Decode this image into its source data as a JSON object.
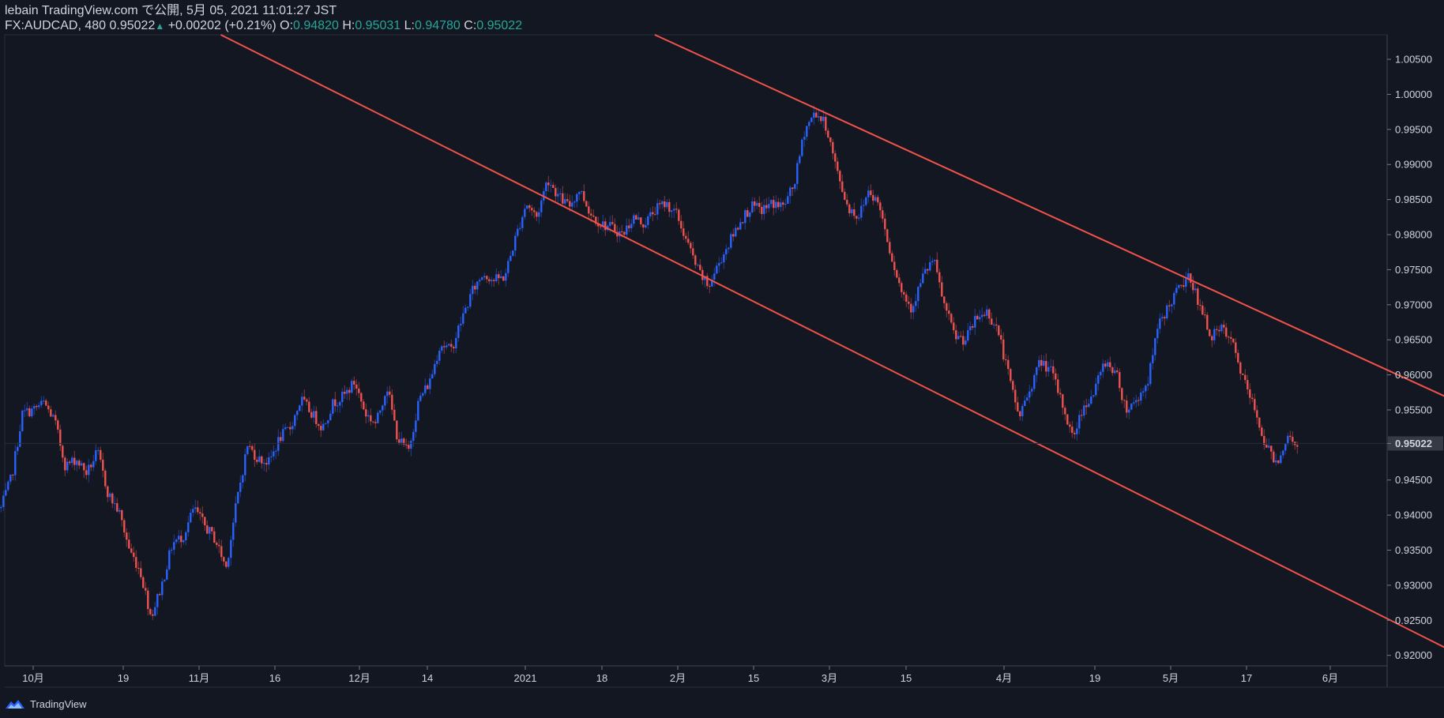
{
  "header": {
    "line1": "lebain TradingView.com で公開, 5月 05, 2021 11:01:27 JST",
    "symbol": "FX:AUDCAD, 480",
    "last": "0.95022",
    "arrow": "▲",
    "change": "+0.00202 (+0.21%)",
    "o_label": "O:",
    "o_value": "0.94820",
    "h_label": "H:",
    "h_value": "0.95031",
    "l_label": "L:",
    "l_value": "0.94780",
    "c_label": "C:",
    "c_value": "0.95022"
  },
  "footer": {
    "brand": "TradingView",
    "logo_icon": "tradingview-logo-icon"
  },
  "colors": {
    "background": "#131722",
    "up": "#2962ff",
    "down": "#ef5350",
    "trendline": "#f0524a",
    "last_label_bg": "#363a45",
    "text": "#d1d4dc"
  },
  "chart_data": {
    "type": "candlestick",
    "symbol": "FX:AUDCAD",
    "interval": "480",
    "x_ticks": [
      "10月",
      "19",
      "11月",
      "16",
      "12月",
      "14",
      "2021",
      "18",
      "2月",
      "15",
      "3月",
      "15",
      "4月",
      "19",
      "5月",
      "17",
      "6月"
    ],
    "y_ticks": [
      "1.00500",
      "1.00000",
      "0.99500",
      "0.99000",
      "0.98500",
      "0.98000",
      "0.97500",
      "0.97000",
      "0.96500",
      "0.96000",
      "0.95500",
      "0.95022",
      "0.94500",
      "0.94000",
      "0.93500",
      "0.93000",
      "0.92500",
      "0.92000"
    ],
    "ylim": [
      0.9185,
      1.0085
    ],
    "last_price": 0.95022,
    "close_path": [
      [
        "2020-09-25",
        0.941
      ],
      [
        "2020-09-27",
        0.9455
      ],
      [
        "2020-09-29",
        0.9545
      ],
      [
        "2020-10-01",
        0.955
      ],
      [
        "2020-10-03",
        0.956
      ],
      [
        "2020-10-05",
        0.9535
      ],
      [
        "2020-10-07",
        0.947
      ],
      [
        "2020-10-09",
        0.948
      ],
      [
        "2020-10-11",
        0.946
      ],
      [
        "2020-10-13",
        0.949
      ],
      [
        "2020-10-15",
        0.943
      ],
      [
        "2020-10-17",
        0.9405
      ],
      [
        "2020-10-19",
        0.935
      ],
      [
        "2020-10-21",
        0.932
      ],
      [
        "2020-10-23",
        0.9255
      ],
      [
        "2020-10-25",
        0.93
      ],
      [
        "2020-10-27",
        0.936
      ],
      [
        "2020-10-29",
        0.937
      ],
      [
        "2020-10-31",
        0.941
      ],
      [
        "2020-11-02",
        0.9385
      ],
      [
        "2020-11-04",
        0.9365
      ],
      [
        "2020-11-06",
        0.9325
      ],
      [
        "2020-11-08",
        0.942
      ],
      [
        "2020-11-10",
        0.95
      ],
      [
        "2020-11-12",
        0.948
      ],
      [
        "2020-11-14",
        0.9475
      ],
      [
        "2020-11-16",
        0.951
      ],
      [
        "2020-11-18",
        0.9525
      ],
      [
        "2020-11-20",
        0.9565
      ],
      [
        "2020-11-22",
        0.9545
      ],
      [
        "2020-11-24",
        0.9525
      ],
      [
        "2020-11-26",
        0.956
      ],
      [
        "2020-11-28",
        0.957
      ],
      [
        "2020-11-30",
        0.959
      ],
      [
        "2020-12-02",
        0.9545
      ],
      [
        "2020-12-04",
        0.953
      ],
      [
        "2020-12-06",
        0.9585
      ],
      [
        "2020-12-08",
        0.951
      ],
      [
        "2020-12-10",
        0.949
      ],
      [
        "2020-12-12",
        0.9565
      ],
      [
        "2020-12-14",
        0.959
      ],
      [
        "2020-12-16",
        0.9645
      ],
      [
        "2020-12-18",
        0.9635
      ],
      [
        "2020-12-20",
        0.968
      ],
      [
        "2020-12-22",
        0.972
      ],
      [
        "2020-12-24",
        0.9745
      ],
      [
        "2020-12-26",
        0.9735
      ],
      [
        "2020-12-28",
        0.974
      ],
      [
        "2020-12-30",
        0.9795
      ],
      [
        "2021-01-01",
        0.9845
      ],
      [
        "2021-01-03",
        0.9825
      ],
      [
        "2021-01-05",
        0.988
      ],
      [
        "2021-01-07",
        0.9855
      ],
      [
        "2021-01-09",
        0.984
      ],
      [
        "2021-01-11",
        0.9865
      ],
      [
        "2021-01-13",
        0.983
      ],
      [
        "2021-01-15",
        0.9815
      ],
      [
        "2021-01-17",
        0.981
      ],
      [
        "2021-01-19",
        0.98
      ],
      [
        "2021-01-21",
        0.9825
      ],
      [
        "2021-01-23",
        0.9815
      ],
      [
        "2021-01-25",
        0.9835
      ],
      [
        "2021-01-27",
        0.9845
      ],
      [
        "2021-01-29",
        0.983
      ],
      [
        "2021-01-31",
        0.979
      ],
      [
        "2021-02-02",
        0.975
      ],
      [
        "2021-02-04",
        0.9725
      ],
      [
        "2021-02-06",
        0.976
      ],
      [
        "2021-02-08",
        0.979
      ],
      [
        "2021-02-10",
        0.982
      ],
      [
        "2021-02-12",
        0.984
      ],
      [
        "2021-02-14",
        0.9835
      ],
      [
        "2021-02-16",
        0.9845
      ],
      [
        "2021-02-18",
        0.984
      ],
      [
        "2021-02-20",
        0.987
      ],
      [
        "2021-02-22",
        0.995
      ],
      [
        "2021-02-24",
        0.9975
      ],
      [
        "2021-02-26",
        0.9955
      ],
      [
        "2021-02-28",
        0.989
      ],
      [
        "2021-03-02",
        0.984
      ],
      [
        "2021-03-04",
        0.9825
      ],
      [
        "2021-03-06",
        0.9865
      ],
      [
        "2021-03-08",
        0.984
      ],
      [
        "2021-03-10",
        0.9775
      ],
      [
        "2021-03-12",
        0.972
      ],
      [
        "2021-03-14",
        0.9695
      ],
      [
        "2021-03-16",
        0.974
      ],
      [
        "2021-03-18",
        0.9765
      ],
      [
        "2021-03-20",
        0.97
      ],
      [
        "2021-03-22",
        0.9655
      ],
      [
        "2021-03-24",
        0.965
      ],
      [
        "2021-03-26",
        0.968
      ],
      [
        "2021-03-28",
        0.969
      ],
      [
        "2021-03-30",
        0.9665
      ],
      [
        "2021-04-01",
        0.96
      ],
      [
        "2021-04-03",
        0.954
      ],
      [
        "2021-04-05",
        0.958
      ],
      [
        "2021-04-07",
        0.962
      ],
      [
        "2021-04-09",
        0.9605
      ],
      [
        "2021-04-11",
        0.956
      ],
      [
        "2021-04-13",
        0.951
      ],
      [
        "2021-04-15",
        0.9555
      ],
      [
        "2021-04-17",
        0.9575
      ],
      [
        "2021-04-19",
        0.962
      ],
      [
        "2021-04-21",
        0.9605
      ],
      [
        "2021-04-23",
        0.955
      ],
      [
        "2021-04-25",
        0.9565
      ],
      [
        "2021-04-27",
        0.959
      ],
      [
        "2021-04-29",
        0.967
      ],
      [
        "2021-05-01",
        0.97
      ],
      [
        "2021-05-03",
        0.9725
      ],
      [
        "2021-05-05",
        0.974
      ],
      [
        "2021-05-07",
        0.969
      ],
      [
        "2021-05-09",
        0.9655
      ],
      [
        "2021-05-11",
        0.9665
      ],
      [
        "2021-05-13",
        0.964
      ],
      [
        "2021-05-15",
        0.959
      ],
      [
        "2021-05-17",
        0.955
      ],
      [
        "2021-05-19",
        0.95
      ],
      [
        "2021-05-21",
        0.9475
      ],
      [
        "2021-05-23",
        0.951
      ],
      [
        "2021-05-25",
        0.9502
      ]
    ],
    "trendlines": [
      {
        "name": "",
        "from": [
          "2020-11-05",
          1.0085
        ],
        "to": [
          "2021-06-27",
          0.919
        ]
      },
      {
        "name": "",
        "from": [
          "2021-01-25",
          1.0085
        ],
        "to": [
          "2021-06-27",
          0.955
        ]
      }
    ],
    "grid": false,
    "legend": "none"
  }
}
